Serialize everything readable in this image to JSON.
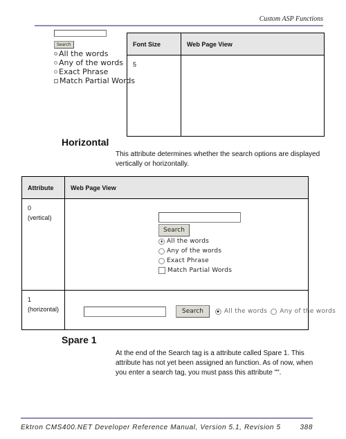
{
  "header": {
    "running_title": "Custom ASP Functions"
  },
  "font_size_table": {
    "columns": [
      "Font Size",
      "Web Page View"
    ],
    "rows": [
      {
        "value": "5",
        "widget": {
          "search_input_value": "",
          "search_button": "Search",
          "options": [
            {
              "type": "radio",
              "label": "All the words",
              "checked": true
            },
            {
              "type": "radio",
              "label": "Any of the words",
              "checked": false
            },
            {
              "type": "radio",
              "label": "Exact Phrase",
              "checked": false
            },
            {
              "type": "checkbox",
              "label": "Match Partial Words",
              "checked": false
            }
          ]
        }
      }
    ]
  },
  "horizontal_section": {
    "heading": "Horizontal",
    "description": "This attribute determines whether the search options are displayed vertically or horizontally."
  },
  "attribute_table": {
    "columns": [
      "Attribute",
      "Web Page View"
    ],
    "rows": [
      {
        "value": "0",
        "note": "(vertical)",
        "widget": {
          "search_input_value": "",
          "search_button": "Search",
          "options": [
            {
              "type": "radio",
              "label": "All the words",
              "checked": true
            },
            {
              "type": "radio",
              "label": "Any of the words",
              "checked": false
            },
            {
              "type": "radio",
              "label": "Exact Phrase",
              "checked": false
            },
            {
              "type": "checkbox",
              "label": "Match Partial Words",
              "checked": false
            }
          ]
        }
      },
      {
        "value": "1",
        "note": "(horizontal)",
        "widget": {
          "search_input_value": "",
          "search_button": "Search",
          "options": [
            {
              "type": "radio",
              "label": "All the words",
              "checked": true
            },
            {
              "type": "radio",
              "label": "Any of the words",
              "checked": false
            }
          ]
        }
      }
    ]
  },
  "spare_section": {
    "heading": "Spare 1",
    "description": "At the end of the Search tag is a attribute called Spare 1. This attribute has not yet been assigned an function. As of now, when you enter a search tag, you must pass this attribute \"\"."
  },
  "footer": {
    "manual_title": "Ektron CMS400.NET Developer Reference Manual, Version 5.1, Revision 5",
    "page_number": "388"
  },
  "colors": {
    "rule": "#8c8cb4",
    "table_header_bg": "#e6e6e6"
  }
}
